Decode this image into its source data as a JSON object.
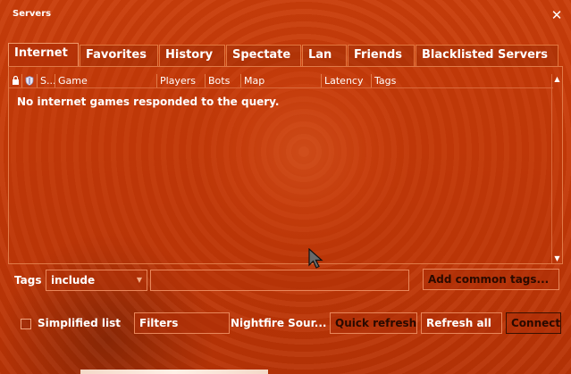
{
  "window": {
    "title": "Servers"
  },
  "tabs": [
    {
      "label": "Internet",
      "active": true
    },
    {
      "label": "Favorites"
    },
    {
      "label": "History"
    },
    {
      "label": "Spectate"
    },
    {
      "label": "Lan"
    },
    {
      "label": "Friends"
    },
    {
      "label": "Blacklisted Servers"
    }
  ],
  "columns": [
    "S...",
    "Game",
    "Players",
    "Bots",
    "Map",
    "Latency",
    "Tags"
  ],
  "empty_message": "No internet games responded to the query.",
  "tags": {
    "label": "Tags",
    "mode": "include",
    "value": "",
    "add_button": "Add common tags..."
  },
  "footer": {
    "simplified_label": "Simplified list",
    "simplified_checked": false,
    "filters_button": "Filters",
    "game_name": "Nightfire Sour...",
    "quick_refresh": "Quick refresh",
    "refresh_all": "Refresh all",
    "connect": "Connect"
  },
  "colors": {
    "accent": "#c63a08",
    "border": "#e07a48"
  }
}
